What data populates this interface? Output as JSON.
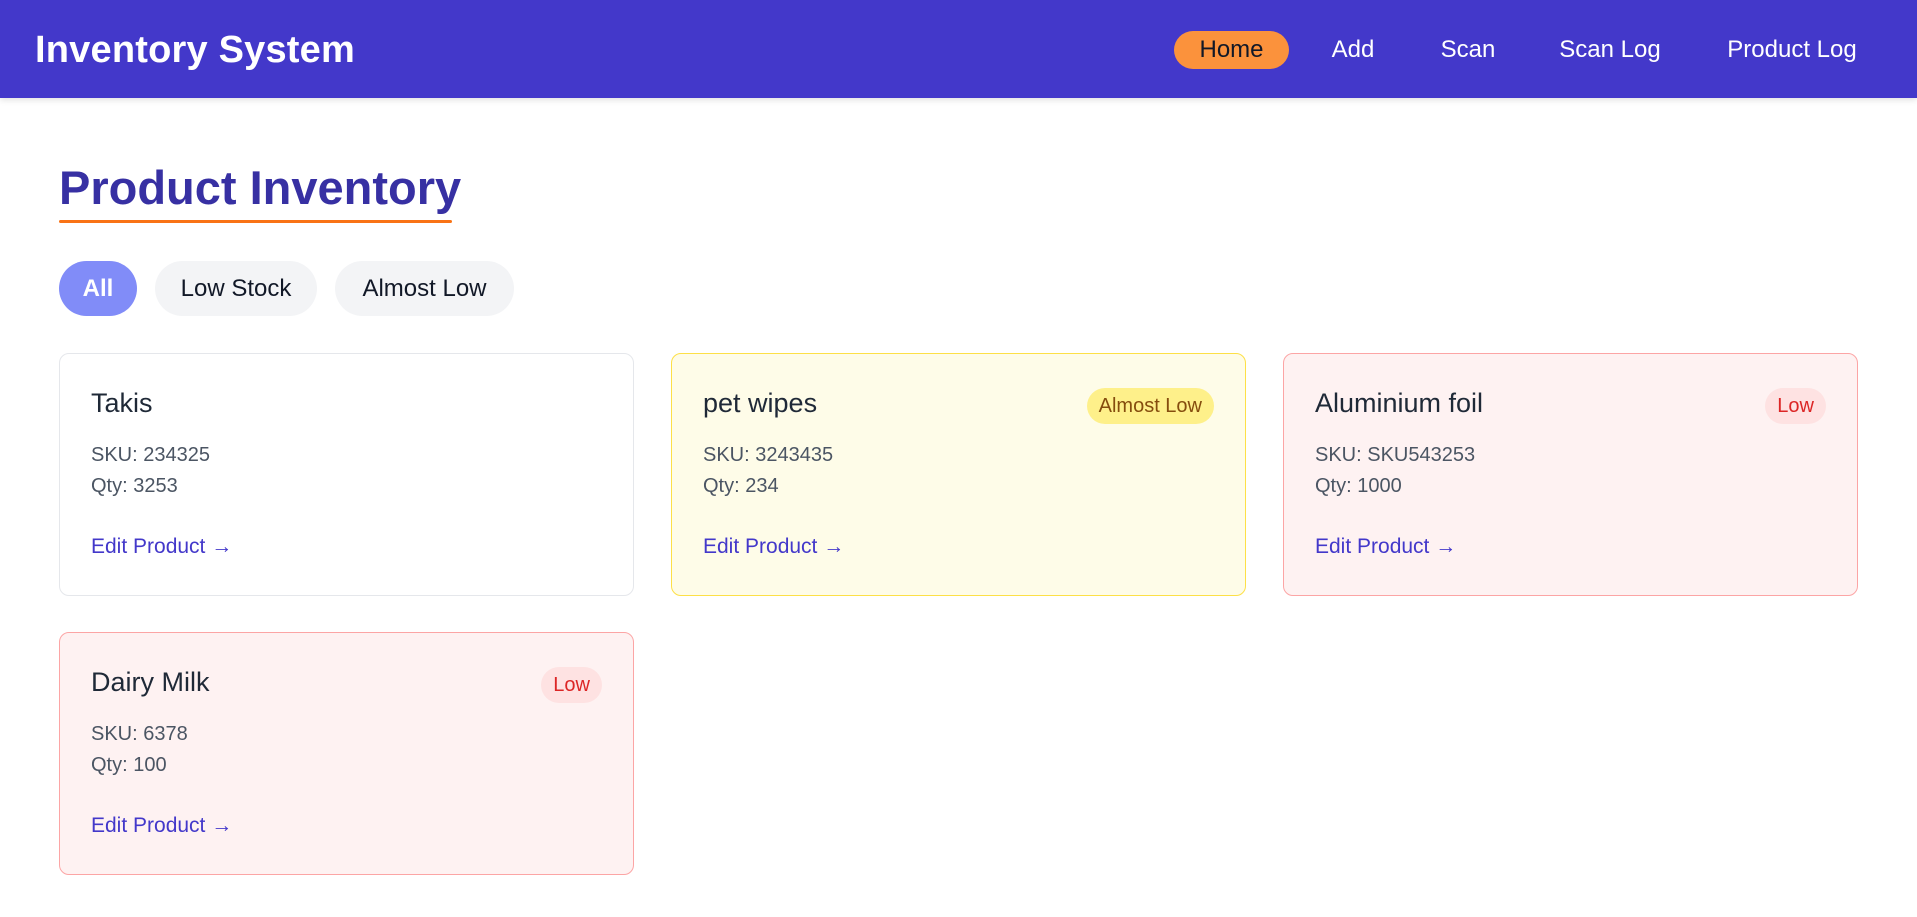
{
  "navbar": {
    "brand": "Inventory System",
    "links": [
      {
        "label": "Home",
        "active": true
      },
      {
        "label": "Add",
        "active": false
      },
      {
        "label": "Scan",
        "active": false
      },
      {
        "label": "Scan Log",
        "active": false
      },
      {
        "label": "Product Log",
        "active": false
      }
    ]
  },
  "main": {
    "title": "Product Inventory",
    "filters": [
      {
        "label": "All",
        "active": true
      },
      {
        "label": "Low Stock",
        "active": false
      },
      {
        "label": "Almost Low",
        "active": false
      }
    ],
    "products": [
      {
        "name": "Takis",
        "sku": "SKU: 234325",
        "qty": "Qty: 3253",
        "status": "",
        "link": "Edit Product →"
      },
      {
        "name": "pet wipes",
        "sku": "SKU: 3243435",
        "qty": "Qty: 234",
        "status": "Almost Low",
        "link": "Edit Product →"
      },
      {
        "name": "Aluminium foil",
        "sku": "SKU: SKU543253",
        "qty": "Qty: 1000",
        "status": "Low",
        "link": "Edit Product →"
      },
      {
        "name": "Dairy Milk",
        "sku": "SKU: 6378",
        "qty": "Qty: 100",
        "status": "Low",
        "link": "Edit Product →"
      }
    ]
  },
  "colors": {
    "navbar": "#4338ca",
    "active_nav": "#fb923c",
    "title": "#3730a3",
    "active_filter": "#818cf8",
    "almost_low": "#fefce8",
    "low": "#fef2f2"
  }
}
